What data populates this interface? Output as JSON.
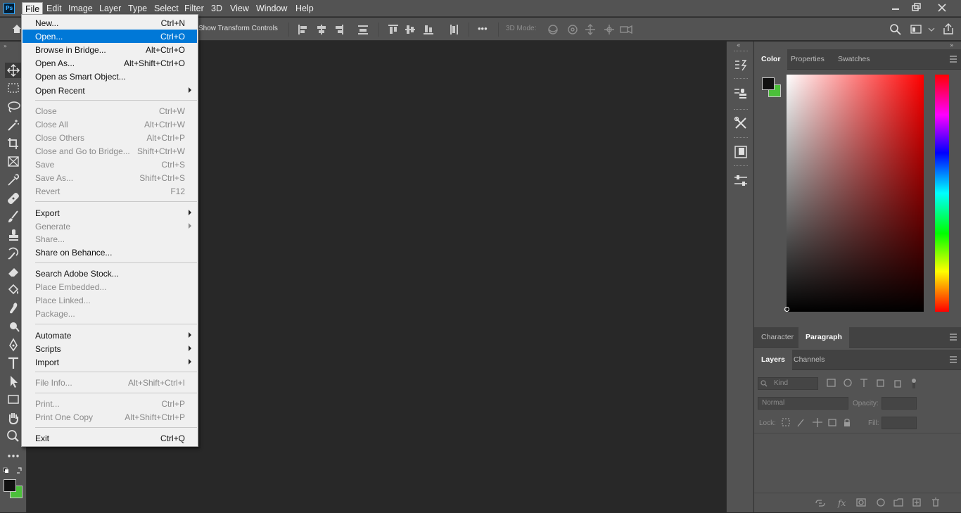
{
  "app": {
    "logo": "Ps",
    "menus": [
      "File",
      "Edit",
      "Image",
      "Layer",
      "Type",
      "Select",
      "Filter",
      "3D",
      "View",
      "Window",
      "Help"
    ],
    "active_menu": "File"
  },
  "options_bar": {
    "show_transform_controls": "Show Transform Controls",
    "mode_3d": "3D Mode:",
    "more": "•••"
  },
  "file_menu": {
    "items": [
      {
        "label": "New...",
        "shortcut": "Ctrl+N"
      },
      {
        "label": "Open...",
        "shortcut": "Ctrl+O"
      },
      {
        "label": "Browse in Bridge...",
        "shortcut": "Alt+Ctrl+O"
      },
      {
        "label": "Open As...",
        "shortcut": "Alt+Shift+Ctrl+O"
      },
      {
        "label": "Open as Smart Object...",
        "shortcut": ""
      },
      {
        "label": "Open Recent",
        "shortcut": ""
      },
      {
        "label": "Close",
        "shortcut": "Ctrl+W"
      },
      {
        "label": "Close All",
        "shortcut": "Alt+Ctrl+W"
      },
      {
        "label": "Close Others",
        "shortcut": "Alt+Ctrl+P"
      },
      {
        "label": "Close and Go to Bridge...",
        "shortcut": "Shift+Ctrl+W"
      },
      {
        "label": "Save",
        "shortcut": "Ctrl+S"
      },
      {
        "label": "Save As...",
        "shortcut": "Shift+Ctrl+S"
      },
      {
        "label": "Revert",
        "shortcut": "F12"
      },
      {
        "label": "Export",
        "shortcut": ""
      },
      {
        "label": "Generate",
        "shortcut": ""
      },
      {
        "label": "Share...",
        "shortcut": ""
      },
      {
        "label": "Share on Behance...",
        "shortcut": ""
      },
      {
        "label": "Search Adobe Stock...",
        "shortcut": ""
      },
      {
        "label": "Place Embedded...",
        "shortcut": ""
      },
      {
        "label": "Place Linked...",
        "shortcut": ""
      },
      {
        "label": "Package...",
        "shortcut": ""
      },
      {
        "label": "Automate",
        "shortcut": ""
      },
      {
        "label": "Scripts",
        "shortcut": ""
      },
      {
        "label": "Import",
        "shortcut": ""
      },
      {
        "label": "File Info...",
        "shortcut": "Alt+Shift+Ctrl+I"
      },
      {
        "label": "Print...",
        "shortcut": "Ctrl+P"
      },
      {
        "label": "Print One Copy",
        "shortcut": "Alt+Shift+Ctrl+P"
      },
      {
        "label": "Exit",
        "shortcut": "Ctrl+Q"
      }
    ],
    "highlighted": "Open...",
    "disabled": [
      "Close",
      "Close All",
      "Close Others",
      "Close and Go to Bridge...",
      "Save",
      "Save As...",
      "Revert",
      "Generate",
      "Share...",
      "Place Embedded...",
      "Place Linked...",
      "Package...",
      "File Info...",
      "Print...",
      "Print One Copy"
    ],
    "submenus": [
      "Open Recent",
      "Export",
      "Generate",
      "Automate",
      "Scripts",
      "Import"
    ]
  },
  "panels": {
    "color_tabs": [
      "Color",
      "Properties",
      "Swatches"
    ],
    "text_tabs": [
      "Character",
      "Paragraph"
    ],
    "layer_tabs": [
      "Layers",
      "Channels"
    ],
    "layers": {
      "kind_placeholder": "Kind",
      "blend_mode": "Normal",
      "opacity_label": "Opacity:",
      "lock_label": "Lock:",
      "fill_label": "Fill:"
    }
  },
  "colors": {
    "foreground": "#111111",
    "background": "#4bbf3a",
    "menu_highlight": "#0078d7",
    "chrome": "#535353"
  }
}
